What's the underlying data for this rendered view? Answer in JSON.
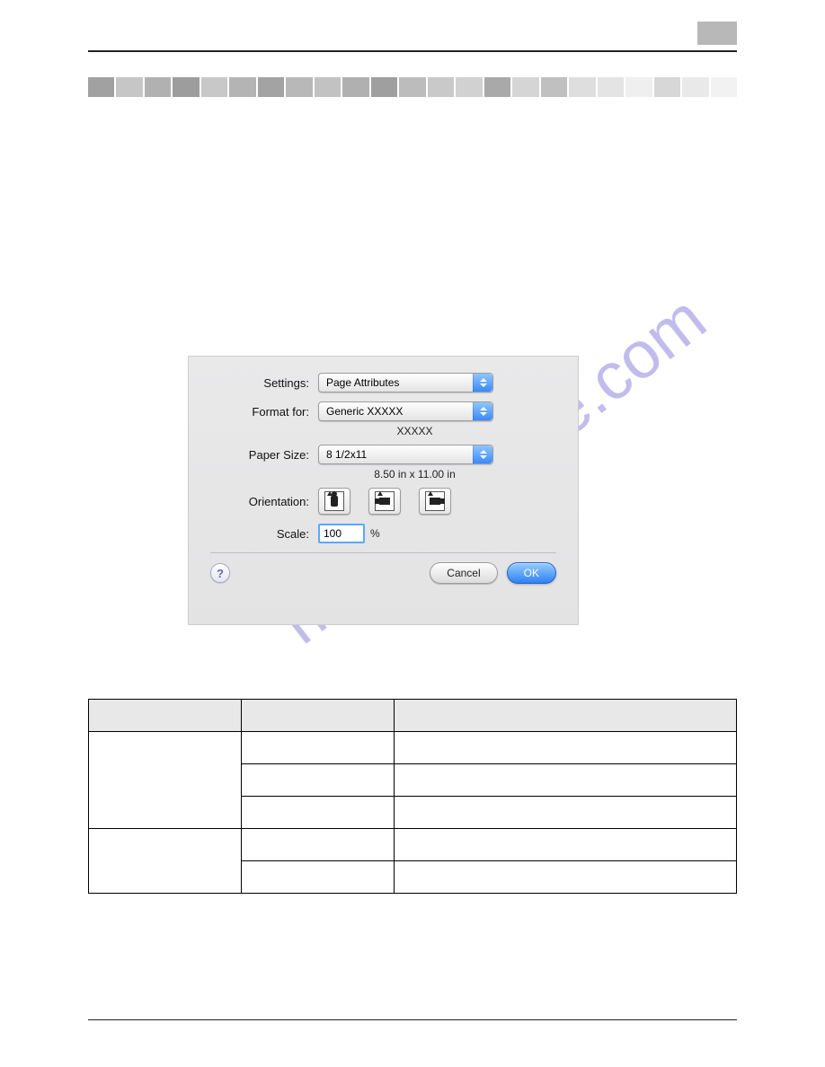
{
  "gray_bar_shades": [
    "#a1a1a1",
    "#c6c6c6",
    "#b1b1b1",
    "#9d9d9d",
    "#c8c8c8",
    "#b4b4b4",
    "#a3a3a3",
    "#b8b8b8",
    "#c2c2c2",
    "#b0b0b0",
    "#9f9f9f",
    "#bcbcbc",
    "#c9c9c9",
    "#d1d1d1",
    "#a9a9a9",
    "#d5d5d5",
    "#c0c0c0",
    "#dedede",
    "#e4e4e4",
    "#efefef",
    "#d7d7d7",
    "#e9e9e9",
    "#f2f2f2"
  ],
  "dialog": {
    "settings_label": "Settings:",
    "settings_value": "Page Attributes",
    "format_for_label": "Format for:",
    "format_for_value": "Generic XXXXX",
    "format_for_sub": "XXXXX",
    "paper_size_label": "Paper Size:",
    "paper_size_value": "8 1/2x11",
    "paper_size_sub": "8.50 in x 11.00 in",
    "orientation_label": "Orientation:",
    "scale_label": "Scale:",
    "scale_value": "100",
    "scale_unit": "%",
    "help_symbol": "?",
    "cancel": "Cancel",
    "ok": "OK"
  },
  "watermark": "manualshive.com"
}
